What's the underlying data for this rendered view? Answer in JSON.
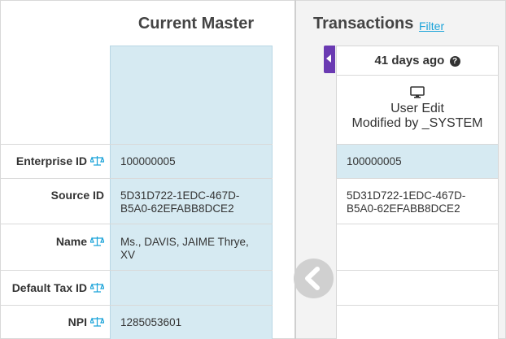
{
  "master": {
    "title": "Current Master",
    "fields": [
      {
        "label": "Enterprise ID",
        "value": "100000005",
        "has_scale_icon": true
      },
      {
        "label": "Source ID",
        "value_line1": "5D31D722-1EDC-467D-",
        "value_line2": "B5A0-62EFABB8DCE2",
        "has_scale_icon": false
      },
      {
        "label": "Name",
        "value_line1": "Ms., DAVIS, JAIME Thrye,",
        "value_line2": "XV",
        "has_scale_icon": true
      },
      {
        "label": "Default Tax ID",
        "value": "",
        "has_scale_icon": true
      },
      {
        "label": "NPI",
        "value": "1285053601",
        "has_scale_icon": true
      }
    ]
  },
  "transactions": {
    "title": "Transactions",
    "filter_label": "Filter",
    "age_label": "41 days ago",
    "edit_type": "User Edit",
    "modified_by": "Modified by _SYSTEM",
    "enterprise_id": "100000005",
    "source_id_line1": "5D31D722-1EDC-467D-",
    "source_id_line2": "B5A0-62EFABB8DCE2"
  },
  "icons": {
    "scale": "balance-scale-icon",
    "help": "question-circle-icon",
    "monitor": "desktop-monitor-icon",
    "collapse": "caret-left-icon",
    "prev": "chevron-left-circle-icon"
  },
  "colors": {
    "accent_blue": "#1aa3d9",
    "highlight_bg": "#d6eaf2",
    "purple_tab": "#6a3ab2"
  }
}
